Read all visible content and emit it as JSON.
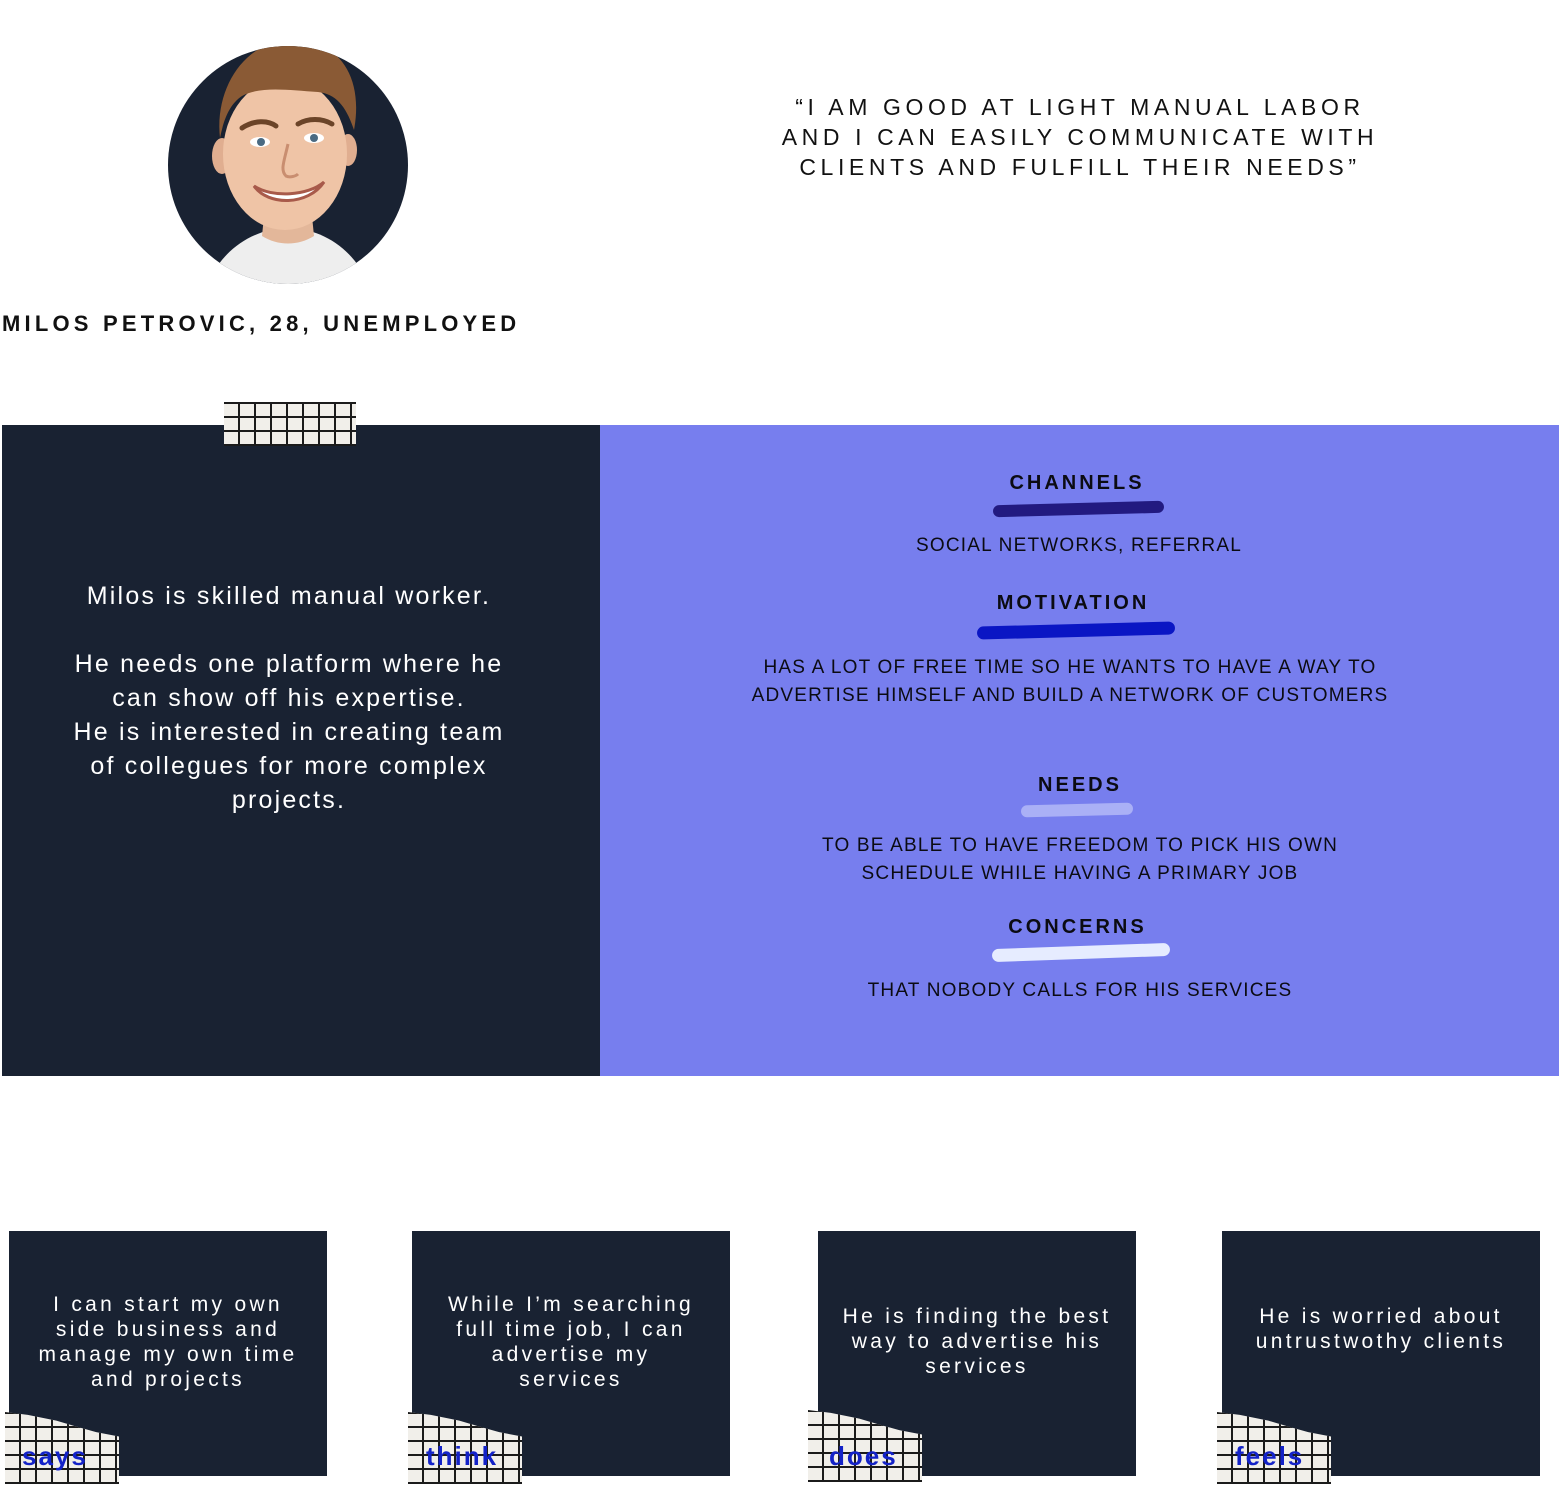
{
  "persona": {
    "name_line": "MILOS PETROVIC, 28, UNEMPLOYED",
    "quote": "“I AM GOOD AT LIGHT MANUAL LABOR AND I CAN EASILY COMMUNICATE WITH CLIENTS AND FULFILL THEIR NEEDS”"
  },
  "bio": {
    "paragraph_1": "Milos is skilled manual worker.",
    "paragraph_2": "He needs one platform where he can show off his expertise.",
    "paragraph_3": "He is interested in creating team of collegues for more complex projects."
  },
  "sections": [
    {
      "title": "CHANNELS",
      "body": "SOCIAL NETWORKS, REFERRAL",
      "bar_color": "#221a80"
    },
    {
      "title": "MOTIVATION",
      "body": "HAS A LOT OF FREE TIME SO HE WANTS TO HAVE A WAY TO ADVERTISE HIMSELF AND BUILD A NETWORK OF CUSTOMERS",
      "bar_color": "#0a16c4"
    },
    {
      "title": "NEEDS",
      "body": "TO BE ABLE TO HAVE FREEDOM TO PICK HIS OWN SCHEDULE WHILE HAVING A PRIMARY JOB",
      "bar_color": "#aab0f6"
    },
    {
      "title": "CONCERNS",
      "body": "THAT NOBODY CALLS FOR HIS SERVICES",
      "bar_color": "#e6ecff"
    }
  ],
  "cards": [
    {
      "label": "says",
      "text": "I can start my own side business and manage my own time and projects"
    },
    {
      "label": "think",
      "text": "While I’m searching full time job, I can advertise my services"
    },
    {
      "label": "does",
      "text": "He is finding the best way to advertise his services"
    },
    {
      "label": "feels",
      "text": "He is worried about untrustwothy clients"
    }
  ],
  "colors": {
    "navy": "#192232",
    "periwinkle": "#777eee",
    "label_blue": "#1322c8"
  }
}
